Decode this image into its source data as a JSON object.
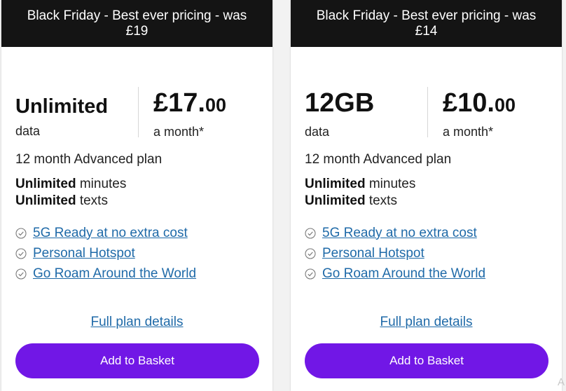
{
  "plans": [
    {
      "banner_line1": "Black Friday - Best ever pricing - was",
      "banner_line2": "£19",
      "data_amount": "Unlimited",
      "data_unit": "data",
      "price_main": "£17.",
      "price_pence": "00",
      "per_month": "a month*",
      "plan_name": "12 month Advanced plan",
      "minutes_bold": "Unlimited",
      "minutes_text": " minutes",
      "texts_bold": "Unlimited",
      "texts_text": " texts",
      "features": [
        "5G Ready at no extra cost",
        "Personal Hotspot",
        "Go Roam Around the World"
      ],
      "details_link": "Full plan details",
      "button_label": "Add to Basket"
    },
    {
      "banner_line1": "Black Friday - Best ever pricing - was",
      "banner_line2": "£14",
      "data_amount": "12GB",
      "data_unit": "data",
      "price_main": "£10.",
      "price_pence": "00",
      "per_month": "a month*",
      "plan_name": "12 month Advanced plan",
      "minutes_bold": "Unlimited",
      "minutes_text": " minutes",
      "texts_bold": "Unlimited",
      "texts_text": " texts",
      "features": [
        "5G Ready at no extra cost",
        "Personal Hotspot",
        "Go Roam Around the World"
      ],
      "details_link": "Full plan details",
      "button_label": "Add to Basket"
    }
  ],
  "corner_text": "A",
  "colors": {
    "banner_bg": "#141414",
    "link": "#1f6aa8",
    "button_bg": "#7117e6",
    "check_icon": "#7a7a7a"
  },
  "icons": {
    "feature_bullet": "check-circle-icon"
  }
}
